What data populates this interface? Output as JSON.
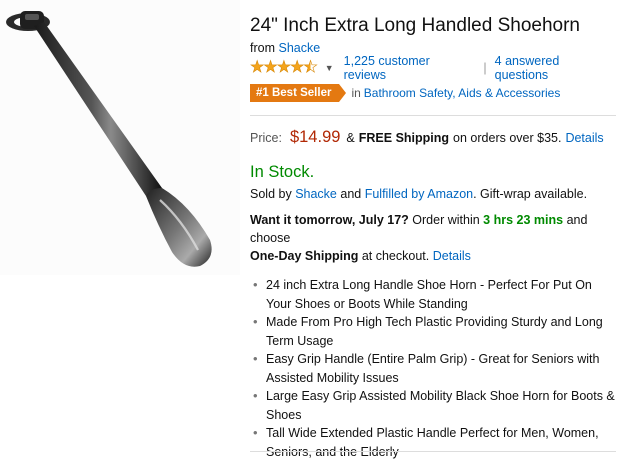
{
  "product": {
    "title": "24\" Inch Extra Long Handled Shoehorn",
    "byline_prefix": "from",
    "brand": "Shacke",
    "rating": 4.5,
    "rating_icon": "star-rating-icon",
    "dropdown_icon": "chevron-down-icon",
    "reviews_label": "1,225 customer reviews",
    "separator": "|",
    "questions_label": "4 answered questions",
    "badge_label": "#1 Best Seller",
    "badge_in": "in",
    "category_label": "Bathroom Safety, Aids & Accessories",
    "image_alt": "shoehorn-image"
  },
  "price": {
    "label": "Price:",
    "value": "$14.99",
    "amp": "&",
    "free_shipping": "FREE Shipping",
    "shipping_note": "on orders over $35.",
    "details_link": "Details"
  },
  "availability": {
    "stock": "In Stock.",
    "sold_by_prefix": "Sold by",
    "seller": "Shacke",
    "and": "and",
    "fulfilled": "Fulfilled by Amazon",
    "gift_wrap": ". Gift-wrap available."
  },
  "delivery": {
    "want_it": "Want it tomorrow, July 17?",
    "order_within": "Order within",
    "countdown": "3 hrs 23 mins",
    "and_choose": "and choose",
    "one_day": "One-Day Shipping",
    "at_checkout": "at checkout.",
    "details_link": "Details"
  },
  "bullets": [
    "24 inch Extra Long Handle Shoe Horn - Perfect For Put On Your Shoes or Boots While Standing",
    "Made From Pro High Tech Plastic Providing Sturdy and Long Term Usage",
    "Easy Grip Handle (Entire Palm Grip) - Great for Seniors with Assisted Mobility Issues",
    "Large Easy Grip Assisted Mobility Black Shoe Horn for Boots & Shoes",
    "Tall Wide Extended Plastic Handle Perfect for Men, Women, Seniors, and the Elderly"
  ],
  "colors": {
    "link": "#0066c0",
    "price": "#b12704",
    "in_stock": "#008a00",
    "badge": "#e47911",
    "star": "#f4a41c"
  }
}
